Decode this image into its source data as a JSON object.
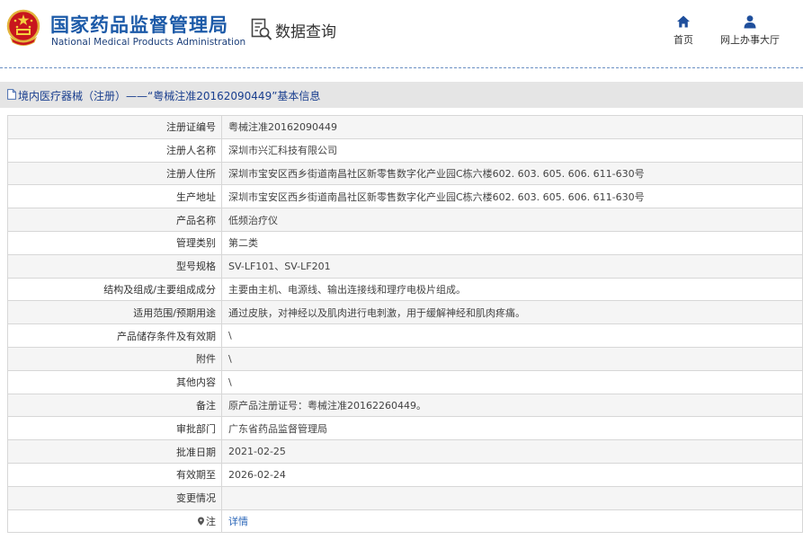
{
  "header": {
    "agency_cn": "国家药品监督管理局",
    "agency_en": "National Medical Products Administration",
    "query_title": "数据查询",
    "nav": {
      "home": "首页",
      "online_service": "网上办事大厅"
    }
  },
  "breadcrumb": "境内医疗器械（注册）——“粤械注准20162090449”基本信息",
  "rows": [
    {
      "label": "注册证编号",
      "value": "粤械注准20162090449"
    },
    {
      "label": "注册人名称",
      "value": "深圳市兴汇科技有限公司"
    },
    {
      "label": "注册人住所",
      "value": "深圳市宝安区西乡街道南昌社区新零售数字化产业园C栋六楼602. 603. 605. 606. 611-630号"
    },
    {
      "label": "生产地址",
      "value": "深圳市宝安区西乡街道南昌社区新零售数字化产业园C栋六楼602. 603. 605. 606. 611-630号"
    },
    {
      "label": "产品名称",
      "value": "低频治疗仪"
    },
    {
      "label": "管理类别",
      "value": "第二类"
    },
    {
      "label": "型号规格",
      "value": "SV-LF101、SV-LF201"
    },
    {
      "label": "结构及组成/主要组成成分",
      "value": "主要由主机、电源线、输出连接线和理疗电极片组成。"
    },
    {
      "label": "适用范围/预期用途",
      "value": "通过皮肤，对神经以及肌肉进行电刺激，用于缓解神经和肌肉疼痛。"
    },
    {
      "label": "产品储存条件及有效期",
      "value": "\\"
    },
    {
      "label": "附件",
      "value": "\\"
    },
    {
      "label": "其他内容",
      "value": "\\"
    },
    {
      "label": "备注",
      "value": "原产品注册证号：粤械注准20162260449。"
    },
    {
      "label": "审批部门",
      "value": "广东省药品监督管理局"
    },
    {
      "label": "批准日期",
      "value": "2021-02-25"
    },
    {
      "label": "有效期至",
      "value": "2026-02-24"
    },
    {
      "label": "变更情况",
      "value": ""
    }
  ],
  "note_row": {
    "label": "注",
    "link": "详情"
  }
}
